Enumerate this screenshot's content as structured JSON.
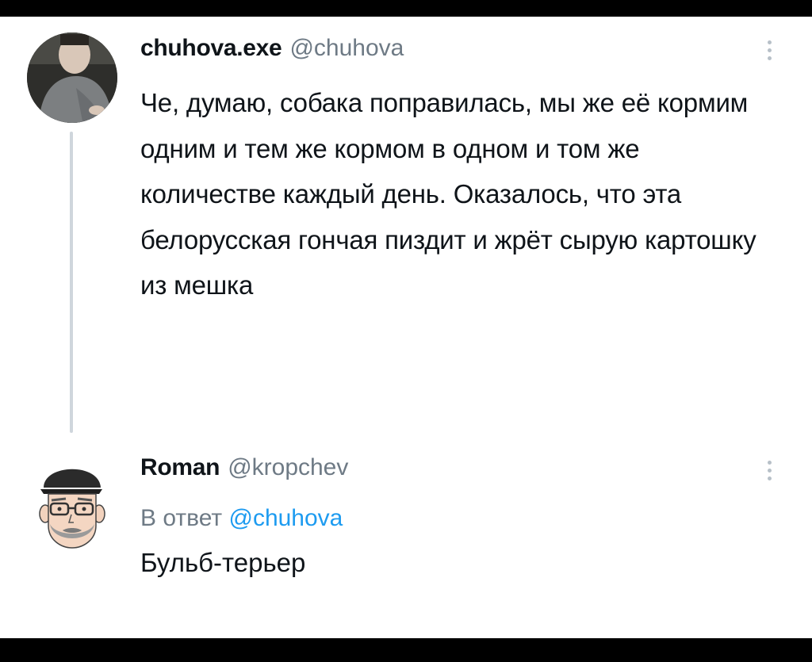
{
  "tweets": [
    {
      "name": "chuhova.exe",
      "handle": "@chuhova",
      "text": "Че, думаю, собака поправилась, мы же её кормим одним и тем же кормом в одном и том же количестве каждый день. Оказалось, что эта белорусская гончая пиздит и жрёт сырую картошку из мешка",
      "avatar_icon": "user-photo-avatar"
    },
    {
      "name": "Roman",
      "handle": "@kropchev",
      "reply_prefix": "В ответ",
      "reply_to": "@chuhova",
      "text": "Бульб-терьер",
      "avatar_icon": "cartoon-man-avatar"
    }
  ],
  "colors": {
    "text": "#0f1419",
    "secondary": "#6e7a85",
    "link": "#1d9bf0",
    "thread_line": "#cfd6dc"
  }
}
